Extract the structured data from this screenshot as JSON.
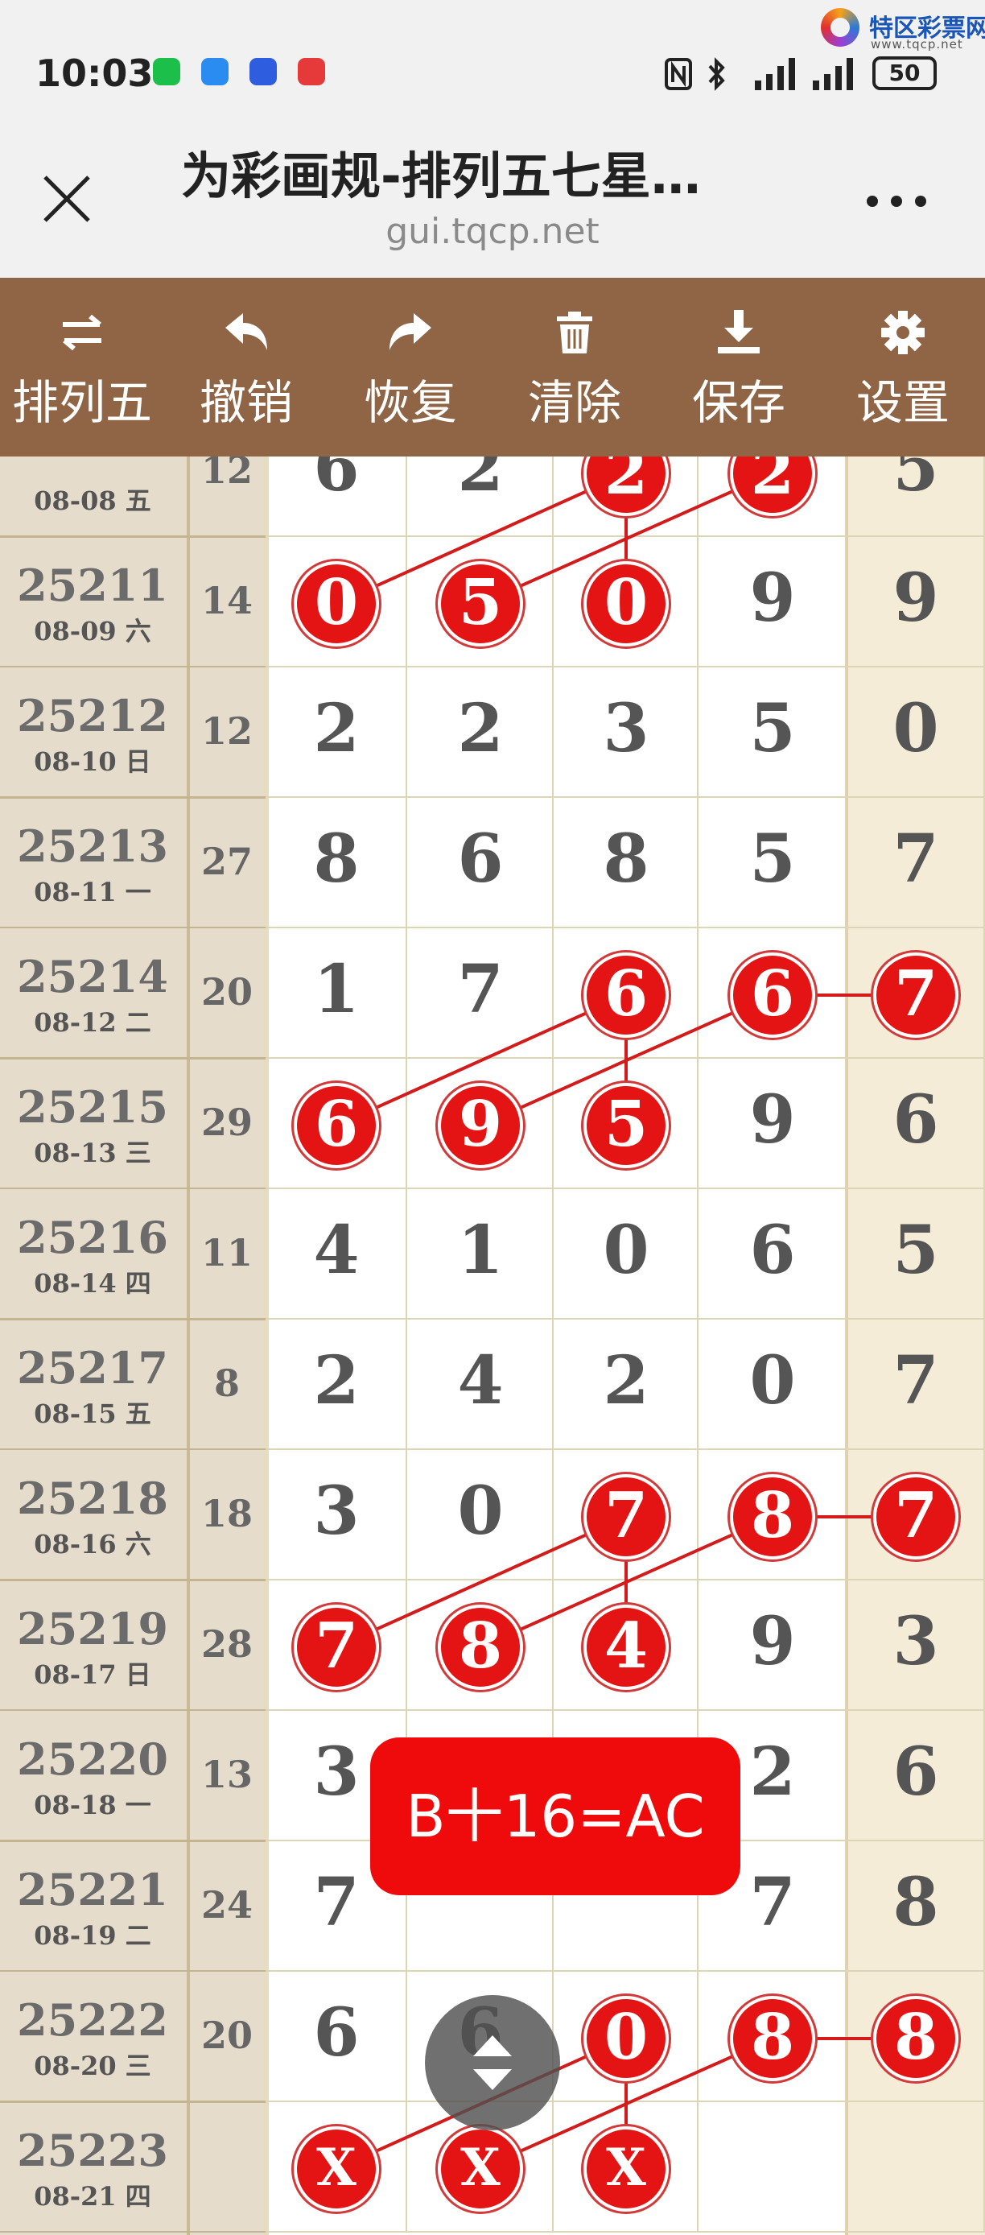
{
  "status_bar": {
    "time": "10:03",
    "battery": "50",
    "app_icon_colors": [
      "#1bbf4a",
      "#2a8cf0",
      "#2f5de0",
      "#e63a3a"
    ]
  },
  "watermark": {
    "name": "特区彩票网",
    "url": "www.tqcp.net"
  },
  "header": {
    "title": "为彩画规-排列五七星…",
    "url": "gui.tqcp.net",
    "close_icon": "close-icon",
    "more_icon": "more-icon"
  },
  "toolbar": {
    "items": [
      {
        "label": "排列五",
        "icon": "swap-arrows-icon"
      },
      {
        "label": "撤销",
        "icon": "undo-icon"
      },
      {
        "label": "恢复",
        "icon": "redo-icon"
      },
      {
        "label": "清除",
        "icon": "trash-icon"
      },
      {
        "label": "保存",
        "icon": "download-icon"
      },
      {
        "label": "设置",
        "icon": "gear-icon"
      }
    ]
  },
  "rows": [
    {
      "issue": "",
      "date": "08-08 五",
      "sum": "12",
      "digits": [
        "6",
        "2",
        "2",
        "2",
        "5"
      ]
    },
    {
      "issue": "25211",
      "date": "08-09 六",
      "sum": "14",
      "digits": [
        "0",
        "5",
        "0",
        "9",
        "9"
      ]
    },
    {
      "issue": "25212",
      "date": "08-10 日",
      "sum": "12",
      "digits": [
        "2",
        "2",
        "3",
        "5",
        "0"
      ]
    },
    {
      "issue": "25213",
      "date": "08-11 一",
      "sum": "27",
      "digits": [
        "8",
        "6",
        "8",
        "5",
        "7"
      ]
    },
    {
      "issue": "25214",
      "date": "08-12 二",
      "sum": "20",
      "digits": [
        "1",
        "7",
        "6",
        "6",
        "7"
      ]
    },
    {
      "issue": "25215",
      "date": "08-13 三",
      "sum": "29",
      "digits": [
        "6",
        "9",
        "5",
        "9",
        "6"
      ]
    },
    {
      "issue": "25216",
      "date": "08-14 四",
      "sum": "11",
      "digits": [
        "4",
        "1",
        "0",
        "6",
        "5"
      ]
    },
    {
      "issue": "25217",
      "date": "08-15 五",
      "sum": "8",
      "digits": [
        "2",
        "4",
        "2",
        "0",
        "7"
      ]
    },
    {
      "issue": "25218",
      "date": "08-16 六",
      "sum": "18",
      "digits": [
        "3",
        "0",
        "7",
        "8",
        "7"
      ]
    },
    {
      "issue": "25219",
      "date": "08-17 日",
      "sum": "28",
      "digits": [
        "7",
        "8",
        "4",
        "9",
        "3"
      ]
    },
    {
      "issue": "25220",
      "date": "08-18 一",
      "sum": "13",
      "digits": [
        "3",
        "",
        "",
        "2",
        "6"
      ]
    },
    {
      "issue": "25221",
      "date": "08-19 二",
      "sum": "24",
      "digits": [
        "7",
        "",
        "",
        "7",
        "8"
      ]
    },
    {
      "issue": "25222",
      "date": "08-20 三",
      "sum": "20",
      "digits": [
        "6",
        "6",
        "0",
        "8",
        "8"
      ]
    },
    {
      "issue": "25223",
      "date": "08-21 四",
      "sum": "",
      "digits": [
        "X",
        "X",
        "X",
        "",
        ""
      ]
    }
  ],
  "circled": [
    [
      0,
      2
    ],
    [
      0,
      3
    ],
    [
      1,
      0
    ],
    [
      1,
      1
    ],
    [
      1,
      2
    ],
    [
      4,
      2
    ],
    [
      4,
      3
    ],
    [
      4,
      4
    ],
    [
      5,
      0
    ],
    [
      5,
      1
    ],
    [
      5,
      2
    ],
    [
      8,
      2
    ],
    [
      8,
      3
    ],
    [
      8,
      4
    ],
    [
      9,
      0
    ],
    [
      9,
      1
    ],
    [
      9,
      2
    ],
    [
      12,
      2
    ],
    [
      12,
      3
    ],
    [
      12,
      4
    ],
    [
      13,
      0
    ],
    [
      13,
      1
    ],
    [
      13,
      2
    ]
  ],
  "links": [
    [
      [
        1,
        0
      ],
      [
        0,
        2
      ]
    ],
    [
      [
        1,
        1
      ],
      [
        0,
        3
      ]
    ],
    [
      [
        0,
        2
      ],
      [
        1,
        2
      ]
    ],
    [
      [
        5,
        0
      ],
      [
        4,
        2
      ]
    ],
    [
      [
        5,
        1
      ],
      [
        4,
        3
      ]
    ],
    [
      [
        4,
        2
      ],
      [
        5,
        2
      ]
    ],
    [
      [
        4,
        3
      ],
      [
        4,
        4
      ]
    ],
    [
      [
        9,
        0
      ],
      [
        8,
        2
      ]
    ],
    [
      [
        9,
        1
      ],
      [
        8,
        3
      ]
    ],
    [
      [
        8,
        2
      ],
      [
        9,
        2
      ]
    ],
    [
      [
        8,
        3
      ],
      [
        8,
        4
      ]
    ],
    [
      [
        13,
        0
      ],
      [
        12,
        2
      ]
    ],
    [
      [
        13,
        1
      ],
      [
        12,
        3
      ]
    ],
    [
      [
        12,
        2
      ],
      [
        13,
        2
      ]
    ],
    [
      [
        12,
        3
      ],
      [
        12,
        4
      ]
    ]
  ],
  "formula": "B十16=AC",
  "colors": {
    "toolbar": "#8f6545",
    "left_column": "#e5dccb",
    "accent_column": "#f5ecd8",
    "ball": "#e51414",
    "link": "#d31b1b",
    "grid_line": "#ddd6b6"
  }
}
